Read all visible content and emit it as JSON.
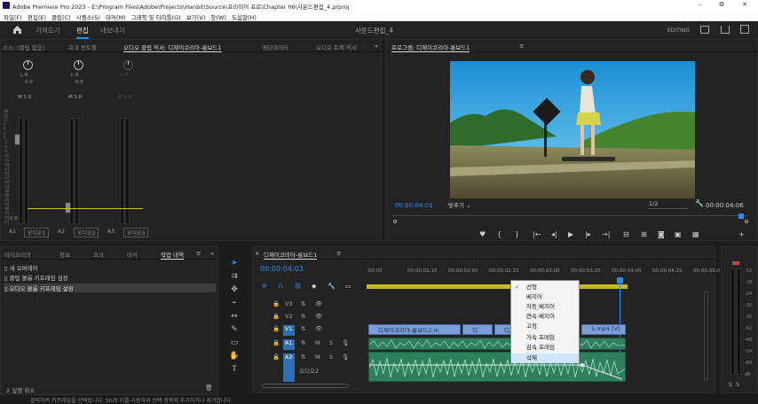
{
  "window": {
    "title": "Adobe Premiere Pro 2023 - E:\\Program Files\\Adobe\\Projects\\Hanbit\\Source\\프리미어 프로\\Chapter 06\\사운드편집_4.prproj",
    "minimize": "–",
    "maximize": "⧉",
    "close": "✕"
  },
  "menu": [
    "파일(F)",
    "편집(E)",
    "클립(C)",
    "시퀀스(S)",
    "마커(M)",
    "그래픽 및 타이틀(G)",
    "보기(V)",
    "창(W)",
    "도움말(H)"
  ],
  "workspace": {
    "home_icon": "home-icon",
    "tabs": [
      "가져오기",
      "편집",
      "내보내기"
    ],
    "project_name": "사운드편집_4",
    "editing": "EDITING"
  },
  "mixer": {
    "tabs": [
      "소스: (클립 없음)",
      "효과 컨트롤",
      "오디오 클립 믹서: 디제이코리아-롱보드1",
      "메타데이터",
      "오디오 트랙 믹서"
    ],
    "channels": [
      {
        "lr": "L  R",
        "val": "0.0",
        "track": "A1",
        "name": "오디오1"
      },
      {
        "lr": "L  R",
        "val": "0.0",
        "track": "A2",
        "name": "오디오2"
      },
      {
        "lr": "L  R",
        "val": "",
        "track": "A3",
        "name": "오디오3"
      }
    ],
    "msr": "M S R",
    "db_scale": [
      "dB",
      "15",
      "12",
      "9",
      "6",
      "3",
      "0",
      "-3",
      "-6",
      "-9",
      "-12",
      "-15",
      "-18",
      "-21",
      "-24",
      "-27",
      "-30",
      "-33",
      "-36",
      "-39",
      "-42",
      "-45",
      "-48",
      "-51",
      "-54",
      "-57"
    ],
    "level": "0.0"
  },
  "program": {
    "title": "프로그램: 디제이코리아-롱보드1",
    "timecode": "00:00:04:03",
    "fit": "맞추기",
    "quality": "1/2",
    "duration": "00:00:04:06"
  },
  "history": {
    "tabs": [
      "라이브러리",
      "정보",
      "효과",
      "마커",
      "작업 내역"
    ],
    "items": [
      "새 오버레이",
      "클립 볼륨 키프레임 설정",
      "오디오 볼륨 키프레임 설정"
    ],
    "undo_count": "2 실행 취소"
  },
  "timeline": {
    "title": "디제이코리아-롱보드1",
    "timecode": "00:00:04:03",
    "ruler": [
      ":00:00",
      "00:00:01:15",
      "00:00:02:00",
      "00:00:02:15",
      "00:00:03:00",
      "00:00:03:15",
      "00:00:04:00",
      "00:00:04:15",
      "00:00:05:0"
    ],
    "video_tracks": [
      "V3",
      "V2",
      "V1"
    ],
    "audio_tracks": [
      "A1",
      "A2"
    ],
    "track_m": "M",
    "track_s": "S",
    "clips": [
      {
        "label": "디제이코리아-롱보드2.m",
        "kind": "video"
      },
      {
        "label": "디",
        "kind": "video"
      },
      {
        "label": "디제",
        "kind": "video"
      },
      {
        "label": "5.mp4 [V]",
        "kind": "video"
      }
    ],
    "audio_label": "오디오2"
  },
  "context_menu": [
    "선형",
    "베지어",
    "자동 베지어",
    "연속 베지어",
    "고정",
    "가속 프레임",
    "감속 프레임",
    "삭제"
  ],
  "context_checked": 0,
  "context_hover": 7,
  "master_meter": {
    "labels": [
      "-12",
      "-18",
      "-24",
      "-30",
      "-36",
      "-42",
      "-48",
      "-54",
      "-60",
      "dB"
    ],
    "solo": [
      "S",
      "S"
    ]
  },
  "status": "클릭하여 키프레임을 선택합니다. Shift 키를 사용하여 선택 항목에 추가하거나 제거합니다."
}
